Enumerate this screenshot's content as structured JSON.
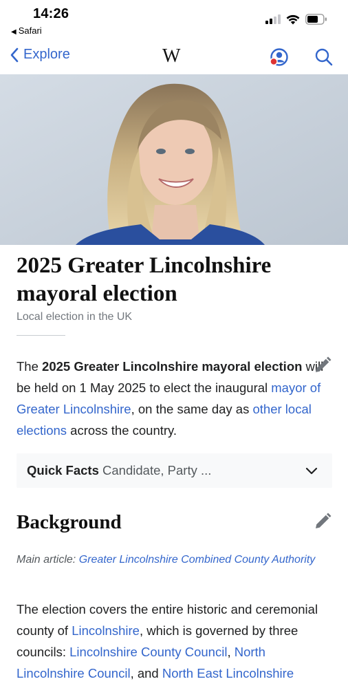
{
  "status_bar": {
    "time": "14:26",
    "back_app": "Safari"
  },
  "nav": {
    "back_label": "Explore",
    "logo": "W"
  },
  "article": {
    "title": "2025 Greater Lincolnshire mayoral election",
    "description": "Local election in the UK",
    "intro": {
      "t1": "The ",
      "bold": "2025 Greater Lincolnshire mayoral election",
      "t2": " will be held on 1 May 2025 to elect the inaugural ",
      "link1": "mayor of Greater Lincolnshire",
      "t3": ", on the same day as ",
      "link2": "other local elections",
      "t4": " across the country."
    },
    "quick_facts": {
      "label": "Quick Facts",
      "summary": "Candidate, Party ..."
    },
    "sections": [
      {
        "heading": "Background",
        "hatnote_prefix": "Main article: ",
        "hatnote_link": "Greater Lincolnshire Combined County Authority",
        "body": {
          "t1": "The election covers the entire historic and ceremonial county of ",
          "link1": "Lincolnshire",
          "t2": ", which is governed by three councils: ",
          "link2": "Lincolnshire County Council",
          "t3": ", ",
          "link3": "North Lincolnshire Council",
          "t4": ", and ",
          "link4": "North East Lincolnshire"
        }
      }
    ]
  },
  "colors": {
    "link": "#3366cc",
    "text": "#202122",
    "muted": "#72777d",
    "quick_facts_bg": "#f8f9fa",
    "account_badge": "#dd3333"
  },
  "icons": [
    "chevron-left-icon",
    "account-icon",
    "search-icon",
    "edit-pencil-icon",
    "chevron-down-icon",
    "signal-icon",
    "wifi-icon",
    "battery-icon"
  ]
}
